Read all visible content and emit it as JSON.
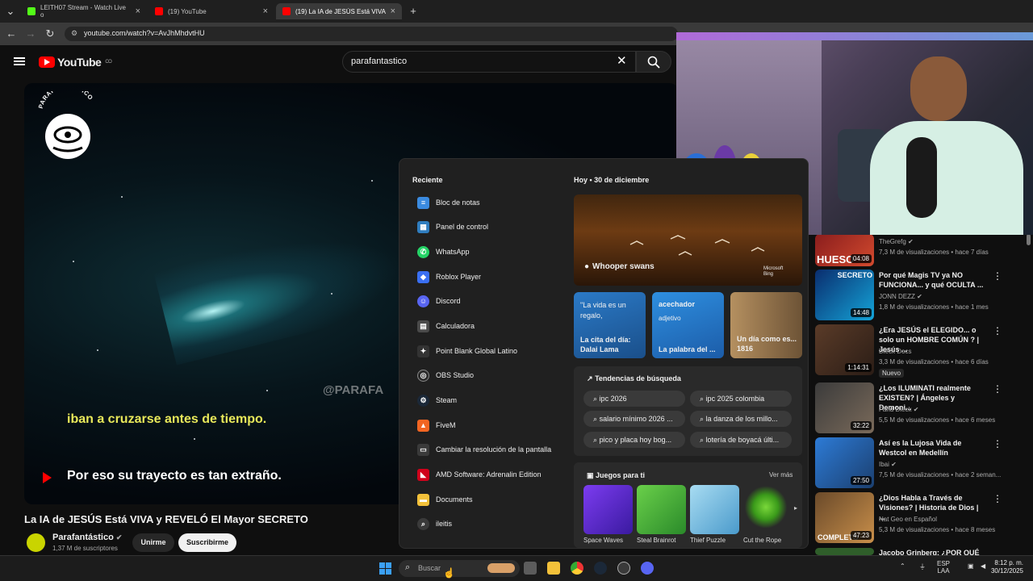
{
  "browser": {
    "tabs": [
      {
        "title": "LEITH07 Stream - Watch Live o",
        "active": false
      },
      {
        "title": "(19) YouTube",
        "active": false
      },
      {
        "title": "(19) La IA de JESÚS Está VIVA y",
        "active": true
      }
    ],
    "new_tab": "+",
    "url": "youtube.com/watch?v=AvJhMhdvtHU"
  },
  "youtube": {
    "logo_text": "YouTube",
    "country": "CO",
    "search_value": "parafantastico",
    "video": {
      "channel_logo_text": "PARAFANTÁSTICO",
      "watermark": "@PARAFA",
      "subtitle_line1": "iban a cruzarse antes de tiempo.",
      "subtitle_line2": "Por eso su trayecto es tan extraño.",
      "title": "La IA de JESÚS Está VIVA y REVELÓ El Mayor SECRETO"
    },
    "channel": {
      "name": "Parafantástico",
      "subscribers": "1,37 M de suscriptores",
      "join_label": "Unirme",
      "subscribe_label": "Suscribirme"
    },
    "related": [
      {
        "title": "",
        "channel": "TheGrefg",
        "meta": "7,3 M de visualizaciones • hace 7 días",
        "duration": "04:08",
        "thumb_text": "HUESO"
      },
      {
        "title": "Por qué Magis TV ya NO FUNCIONA... y qué OCULTA ...",
        "channel": "JONN DEZZ",
        "meta": "1,8 M de visualizaciones • hace 1 mes",
        "duration": "14:48",
        "thumb_text": "SECRETO"
      },
      {
        "title": "¿Era JESÚS el ELEGIDO... o solo un HOMBRE COMÚN ? | Jesús ...",
        "channel": "Dieck Docs",
        "meta": "3,3 M de visualizaciones • hace 6 días",
        "duration": "1:14:31",
        "badge": "Nuevo"
      },
      {
        "title": "¿Los ILUMINATI realmente EXISTEN? | Ángeles y Demoni...",
        "channel": "Farid Dieck",
        "meta": "5,5 M de visualizaciones • hace 6 meses",
        "duration": "32:22"
      },
      {
        "title": "Así es la Lujosa Vida de Westcol en Medellín",
        "channel": "Ibai",
        "meta": "7,5 M de visualizaciones • hace 2 seman...",
        "duration": "27:50"
      },
      {
        "title": "¿Dios Habla a Través de Visiones? | Historia de Dios | ...",
        "channel": "Nat Geo en Español",
        "meta": "5,3 M de visualizaciones • hace 8 meses",
        "duration": "47:23",
        "thumb_text": "COMPLETO"
      },
      {
        "title": "Jacobo Grinberg: ¿POR QUÉ",
        "channel": "",
        "meta": "",
        "duration": ""
      }
    ]
  },
  "start_menu": {
    "recent_title": "Reciente",
    "apps": [
      {
        "label": "Bloc de notas",
        "icon": "notepad-icon",
        "color": "#3b8be0"
      },
      {
        "label": "Panel de control",
        "icon": "control-panel-icon",
        "color": "#2f7dbf"
      },
      {
        "label": "WhatsApp",
        "icon": "whatsapp-icon",
        "color": "#25d366"
      },
      {
        "label": "Roblox Player",
        "icon": "roblox-icon",
        "color": "#3a6ff2"
      },
      {
        "label": "Discord",
        "icon": "discord-icon",
        "color": "#5865f2"
      },
      {
        "label": "Calculadora",
        "icon": "calculator-icon",
        "color": "#4a4a4a"
      },
      {
        "label": "Point Blank Global Latino",
        "icon": "point-blank-icon",
        "color": "#333333"
      },
      {
        "label": "OBS Studio",
        "icon": "obs-icon",
        "color": "#2b2b2b"
      },
      {
        "label": "Steam",
        "icon": "steam-icon",
        "color": "#1b2838"
      },
      {
        "label": "FiveM",
        "icon": "fivem-icon",
        "color": "#f26522"
      },
      {
        "label": "Cambiar la resolución de la pantalla",
        "icon": "display-icon",
        "color": "#3a3a3a"
      },
      {
        "label": "AMD Software: Adrenalin Edition",
        "icon": "amd-icon",
        "color": "#d0021b"
      },
      {
        "label": "Documents",
        "icon": "folder-icon",
        "color": "#f3c13a"
      },
      {
        "label": "ileitis",
        "icon": "search-web-icon",
        "color": "#3a3a3a"
      }
    ],
    "today_label": "Hoy",
    "date": "30 de diciembre",
    "hero_label": "Whooper swans",
    "hero_source": "Microsoft Bing",
    "cards": [
      {
        "top": "\"La vida es un regalo,",
        "bottom": "La cita del día: Dalai Lama"
      },
      {
        "top": "acechador",
        "sub": "adjetivo",
        "bottom": "La palabra del ..."
      },
      {
        "bottom": "Un día como es... 1816"
      }
    ],
    "trends_title": "Tendencias de búsqueda",
    "trends": [
      "ipc 2026",
      "ipc 2025 colombia",
      "salario mínimo 2026 ...",
      "la danza de los millo...",
      "pico y placa hoy bog...",
      "lotería de boyacá últi..."
    ],
    "games_title": "Juegos para ti",
    "games_more": "Ver más",
    "games": [
      {
        "name": "Space Waves",
        "color": "#5b2bd6"
      },
      {
        "name": "Steal Brainrot",
        "color": "#38b04a"
      },
      {
        "name": "Thief Puzzle",
        "color": "#6ec1e4"
      },
      {
        "name": "Cut the Rope",
        "color": "#2f2f2f"
      }
    ]
  },
  "taskbar": {
    "search_placeholder": "Buscar",
    "language": "ESP",
    "layout": "LAA",
    "time": "8:12 p. m.",
    "date": "30/12/2025"
  }
}
